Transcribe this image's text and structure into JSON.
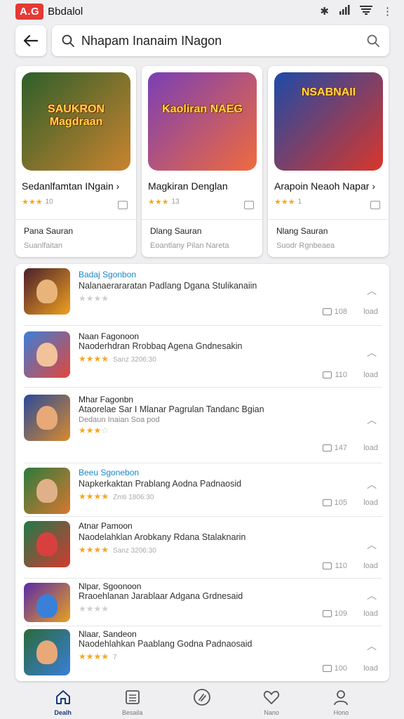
{
  "status_bar": {
    "logo": "A.G",
    "app_name": "Bbdalol",
    "icons": [
      "bluetooth-icon",
      "signal-icon",
      "wifi-icon",
      "more-icon"
    ]
  },
  "search": {
    "back_icon": "arrow-left-icon",
    "query": "Nhapam Inanaim INagon",
    "icon": "search-icon"
  },
  "featured": [
    {
      "art_title": "SAUKRON Magdraan",
      "name": "Sedanlfamtan INgain",
      "arrow": "›",
      "stars": "★★★",
      "rating_text": "10",
      "label": "Pana Sauran",
      "sub": "Suanlfaitan",
      "colors": [
        "#2e5f2a",
        "#c9832f"
      ]
    },
    {
      "art_title": "Kaoliran NAEG",
      "name": "Magkiran Denglan",
      "arrow": "",
      "stars": "★★★",
      "rating_text": "13",
      "label": "Dlang Sauran",
      "sub": "Eoantlany Pilan Nareta",
      "colors": [
        "#7a3fb5",
        "#f06b3d"
      ]
    },
    {
      "art_title": "NSABNAII",
      "name": "Arapoin Neaoh Napar",
      "arrow": "›",
      "stars": "★★★",
      "rating_text": "1",
      "label": "Nlang Sauran",
      "sub": "Suodr Rgnbeaea",
      "colors": [
        "#1d4aa8",
        "#d9372b"
      ]
    }
  ],
  "list": [
    {
      "title": "Badaj Sgonbon",
      "title_blue": true,
      "desc": "Nalanaerararatan Padlang Dgana Stulikanaiin",
      "desc2": "",
      "stars": "★★★★",
      "stars_gray": true,
      "meta": "",
      "count": "108",
      "load": "load",
      "colors": [
        "#4a1f2b",
        "#f0a020"
      ]
    },
    {
      "title": "Naan Fagonoon",
      "title_blue": false,
      "desc": "Naoderhdran Rrobbaq Agena Gndnesakin",
      "desc2": "",
      "stars": "★★★★",
      "stars_gray": false,
      "meta": "Sanz 3206:30",
      "count": "110",
      "load": "load",
      "colors": [
        "#3a7fd8",
        "#e3463b"
      ]
    },
    {
      "title": "Mhar Fagonbn",
      "title_blue": false,
      "desc": "Ataorelae Sar I Mlanar Pagrulan Tandanc Bgian",
      "desc2": "Dedaun Inaian Soa pod",
      "stars": "★★★",
      "stars_gray": false,
      "meta": "",
      "count": "147",
      "load": "load",
      "colors": [
        "#2a4a9a",
        "#d88a2c"
      ]
    },
    {
      "title": "Beeu Sgonebon",
      "title_blue": true,
      "desc": "Napkerkaktan Prablang Aodna Padnaosid",
      "desc2": "",
      "stars": "★★★★",
      "stars_gray": false,
      "meta": "Zmti 1806:30",
      "count": "105",
      "load": "load",
      "colors": [
        "#2d7a3d",
        "#d8782f"
      ]
    },
    {
      "title": "Atnar Pamoon",
      "title_blue": false,
      "desc": "Naodelahklan Arobkany Rdana Stalaknarin",
      "desc2": "",
      "stars": "★★★★",
      "stars_gray": false,
      "meta": "Sanz 3206:30",
      "count": "110",
      "load": "load",
      "colors": [
        "#1f7a4a",
        "#d43a30"
      ]
    },
    {
      "title": "Nlpar, Sgoonoon",
      "title_blue": false,
      "desc": "Rraoehlanan Jarablaar Adgana Grdnesaid",
      "desc2": "",
      "stars": "★★★★",
      "stars_gray": true,
      "meta": "",
      "count": "109",
      "load": "load",
      "colors": [
        "#5a2aa8",
        "#e8a020"
      ]
    },
    {
      "title": "Nlaar, Sandeon",
      "title_blue": false,
      "desc": "Naodehlahkan Paablang Godna Padnaosaid",
      "desc2": "",
      "stars": "★★★★",
      "stars_gray": false,
      "meta": "7",
      "count": "100",
      "load": "load",
      "colors": [
        "#2a6a3a",
        "#3a7fd8"
      ]
    }
  ],
  "bottom_nav": [
    {
      "icon": "home-icon",
      "label": "Dealh",
      "active": true
    },
    {
      "icon": "list-icon",
      "label": "Besaila",
      "active": false
    },
    {
      "icon": "compass-icon",
      "label": "",
      "active": false
    },
    {
      "icon": "heart-icon",
      "label": "Nano",
      "active": false
    },
    {
      "icon": "profile-icon",
      "label": "Hono",
      "active": false
    }
  ]
}
